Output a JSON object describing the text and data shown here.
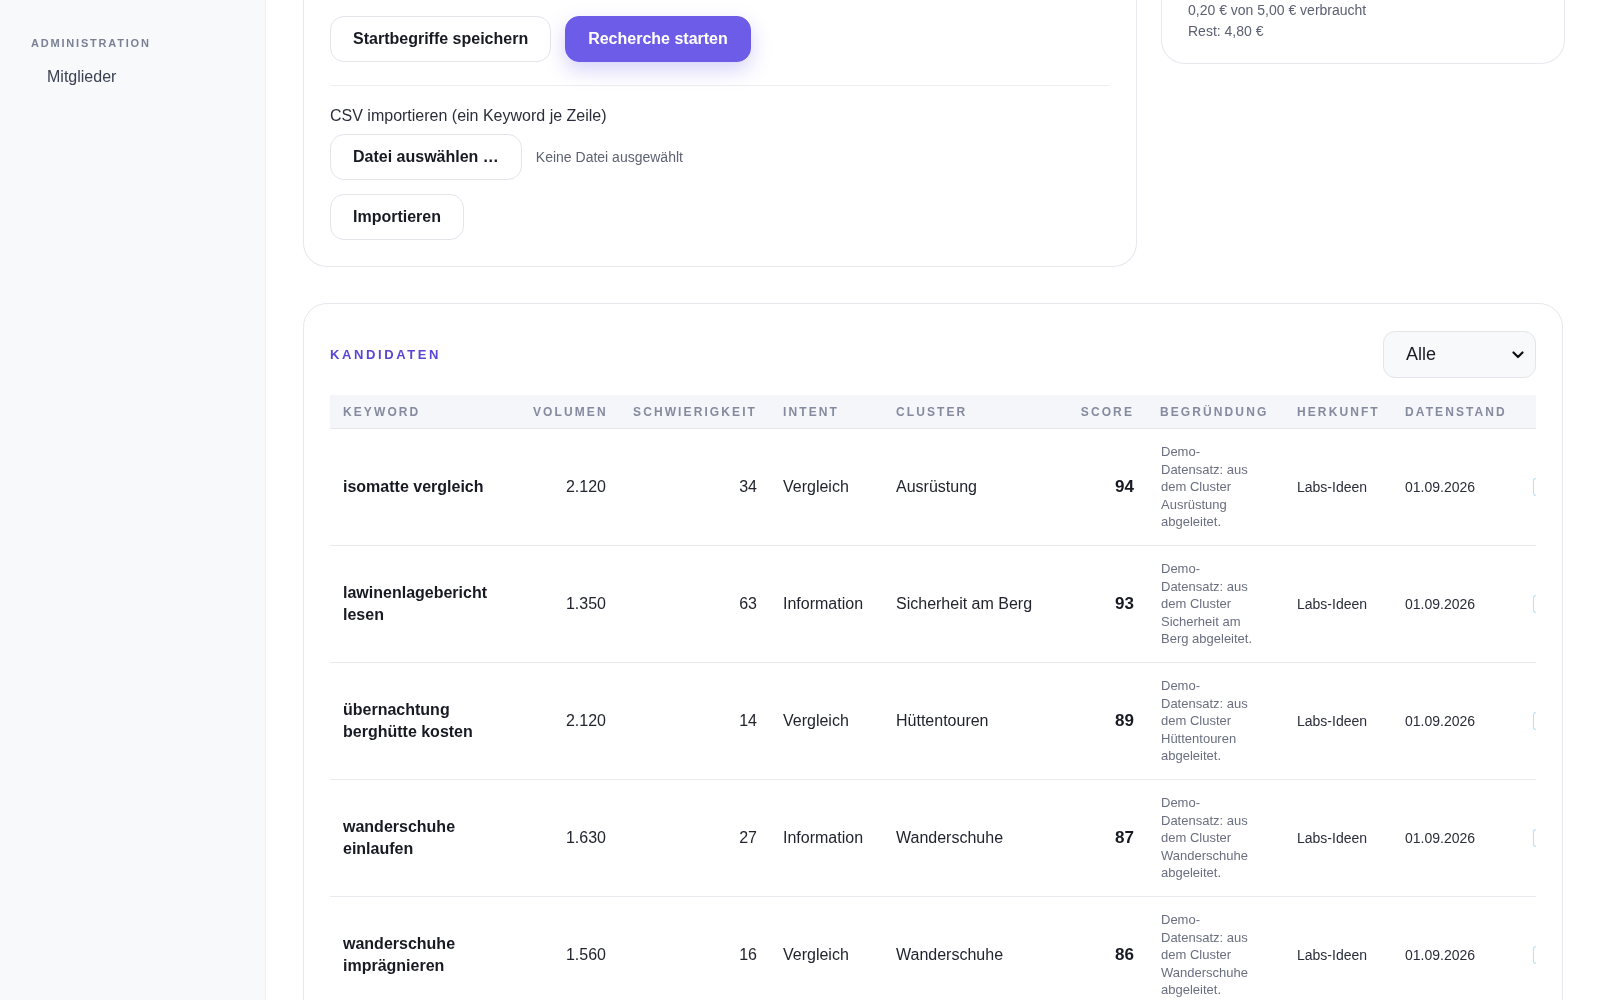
{
  "sidebar": {
    "sections": [
      {
        "title": "ADMINISTRATION",
        "items": [
          {
            "label": "Mitglieder"
          }
        ]
      }
    ]
  },
  "research_card": {
    "buttons": [
      {
        "label": "Startbegriffe speichern",
        "kind": "secondary"
      },
      {
        "label": "Recherche starten",
        "kind": "primary"
      }
    ],
    "csv_import": {
      "label": "CSV importieren (ein Keyword je Zeile)",
      "file_button": "Datei auswählen …",
      "file_status": "Keine Datei ausgewählt",
      "import_button": "Importieren"
    }
  },
  "budget_card": {
    "lines": [
      "0,20 € von 5,00 € verbraucht",
      "Rest: 4,80 €"
    ]
  },
  "candidates": {
    "title": "KANDIDATEN",
    "filter": {
      "value": "Alle"
    },
    "columns": [
      "KEYWORD",
      "VOLUMEN",
      "SCHWIERIGKEIT",
      "INTENT",
      "CLUSTER",
      "SCORE",
      "BEGRÜNDUNG",
      "HERKUNFT",
      "DATENSTAND"
    ],
    "rows": [
      {
        "keyword": "isomatte vergleich",
        "volume": "2.120",
        "difficulty": "34",
        "intent": "Vergleich",
        "cluster": "Ausrüstung",
        "score": "94",
        "reason": "Demo-Datensatz: aus dem Cluster Ausrüstung abgeleitet.",
        "source": "Labs-Ideen",
        "date": "01.09.2026"
      },
      {
        "keyword": "lawinenlagebericht lesen",
        "volume": "1.350",
        "difficulty": "63",
        "intent": "Information",
        "cluster": "Sicherheit am Berg",
        "score": "93",
        "reason": "Demo-Datensatz: aus dem Cluster Sicherheit am Berg abgeleitet.",
        "source": "Labs-Ideen",
        "date": "01.09.2026"
      },
      {
        "keyword": "übernachtung berghütte kosten",
        "volume": "2.120",
        "difficulty": "14",
        "intent": "Vergleich",
        "cluster": "Hüttentouren",
        "score": "89",
        "reason": "Demo-Datensatz: aus dem Cluster Hüttentouren abgeleitet.",
        "source": "Labs-Ideen",
        "date": "01.09.2026"
      },
      {
        "keyword": "wanderschuhe einlaufen",
        "volume": "1.630",
        "difficulty": "27",
        "intent": "Information",
        "cluster": "Wanderschuhe",
        "score": "87",
        "reason": "Demo-Datensatz: aus dem Cluster Wanderschuhe abgeleitet.",
        "source": "Labs-Ideen",
        "date": "01.09.2026"
      },
      {
        "keyword": "wanderschuhe imprägnieren",
        "volume": "1.560",
        "difficulty": "16",
        "intent": "Vergleich",
        "cluster": "Wanderschuhe",
        "score": "86",
        "reason": "Demo-Datensatz: aus dem Cluster Wanderschuhe abgeleitet.",
        "source": "Labs-Ideen",
        "date": "01.09.2026"
      }
    ]
  }
}
